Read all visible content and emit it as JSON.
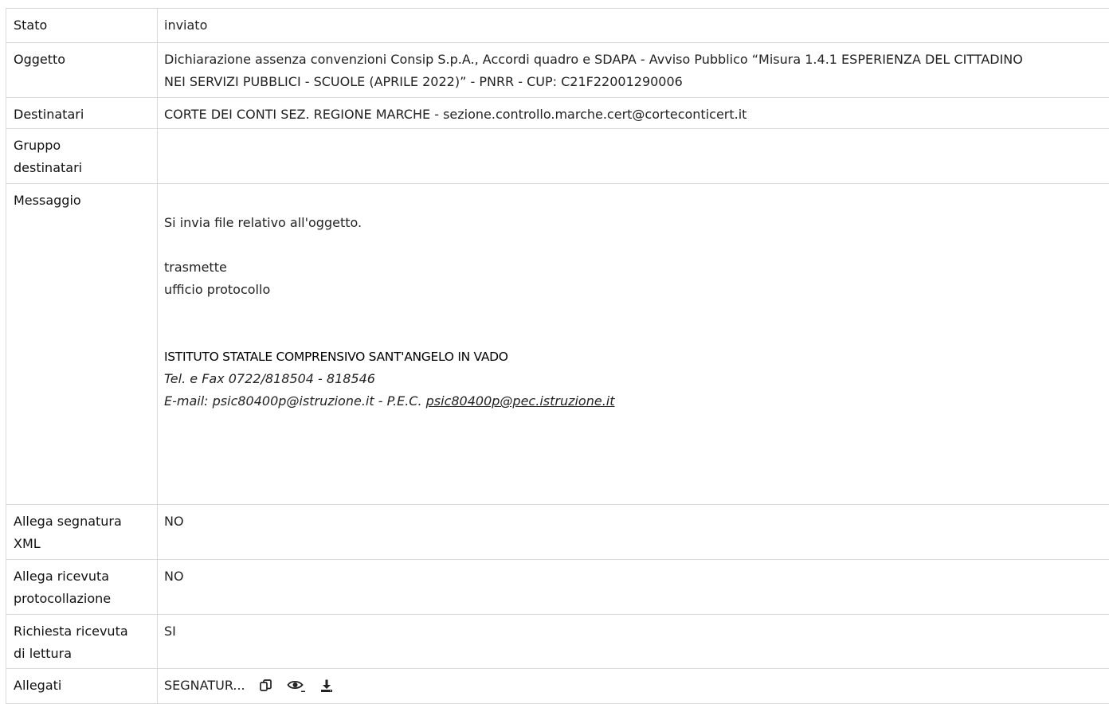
{
  "rows": {
    "stato": {
      "label": "Stato",
      "value": "inviato"
    },
    "oggetto": {
      "label": "Oggetto",
      "value_line1": "Dichiarazione assenza convenzioni Consip S.p.A., Accordi quadro e SDAPA - Avviso Pubblico “Misura 1.4.1 ESPERIENZA DEL CITTADINO",
      "value_line2": "NEI SERVIZI PUBBLICI - SCUOLE (APRILE 2022)” - PNRR - CUP: C21F22001290006"
    },
    "destinatari": {
      "label": "Destinatari",
      "value": "CORTE DEI CONTI SEZ. REGIONE MARCHE - sezione.controllo.marche.cert@corteconticert.it"
    },
    "gruppo_destinatari": {
      "label_line1": "Gruppo",
      "label_line2": "destinatari",
      "value": ""
    },
    "messaggio": {
      "label": "Messaggio",
      "intro": "Si invia file relativo all'oggetto.",
      "sender_line1": "trasmette",
      "sender_line2": "ufficio protocollo",
      "org_name": "ISTITUTO STATALE COMPRENSIVO SANT'ANGELO IN VADO",
      "tel": "Tel. e Fax 0722/818504 - 818546",
      "email_prefix": "E-mail: psic80400p@istruzione.it - P.E.C. ",
      "pec_link": "psic80400p@pec.istruzione.it"
    },
    "allega_segnatura": {
      "label_line1": "Allega segnatura",
      "label_line2": "XML",
      "value": "NO"
    },
    "allega_ricevuta": {
      "label_line1": "Allega ricevuta",
      "label_line2": "protocollazione",
      "value": "NO"
    },
    "richiesta_ricevuta": {
      "label_line1": "Richiesta ricevuta",
      "label_line2": "di lettura",
      "value": "SI"
    },
    "allegati": {
      "label": "Allegati",
      "file_name": "SEGNATUR...",
      "icons": [
        "copy-icon",
        "eye-icon",
        "download-icon"
      ]
    }
  }
}
